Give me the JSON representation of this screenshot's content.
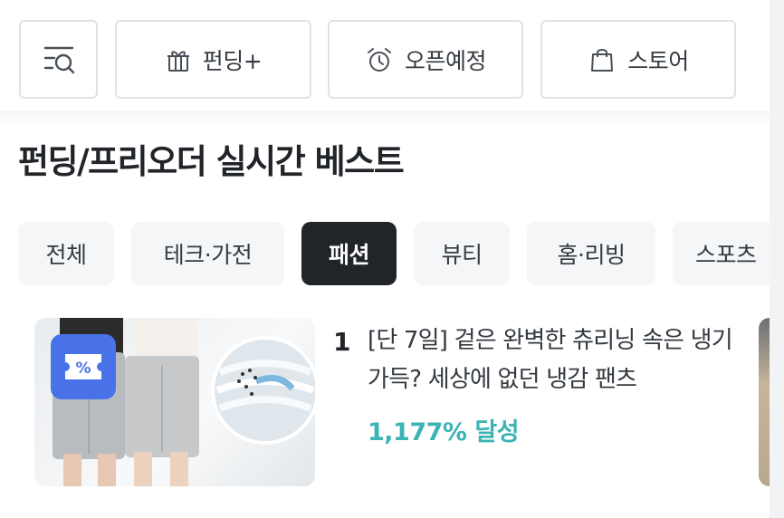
{
  "header": {
    "filter_icon": "search-list-icon",
    "nav": [
      {
        "label": "펀딩+",
        "icon": "gift-icon"
      },
      {
        "label": "오픈예정",
        "icon": "alarm-clock-icon"
      },
      {
        "label": "스토어",
        "icon": "shopping-bag-icon"
      }
    ]
  },
  "section": {
    "title": "펀딩/프리오더 실시간 베스트"
  },
  "categories": {
    "items": [
      "전체",
      "테크·가전",
      "패션",
      "뷰티",
      "홈·리빙",
      "스포츠"
    ],
    "selected": "패션"
  },
  "products": [
    {
      "rank": "1",
      "title": "[단 7일] 겉은 완벽한 츄리닝 속은 냉기 가득? 세상에 없던 냉감 팬츠",
      "achievement": "1,177% 달성",
      "badge_icon": "coupon-icon"
    }
  ],
  "colors": {
    "accent": "#3cb4b4",
    "chip_active_bg": "#212529",
    "chip_bg": "#f5f6f8",
    "badge": "#4a72e8",
    "border": "#dee2e6"
  }
}
